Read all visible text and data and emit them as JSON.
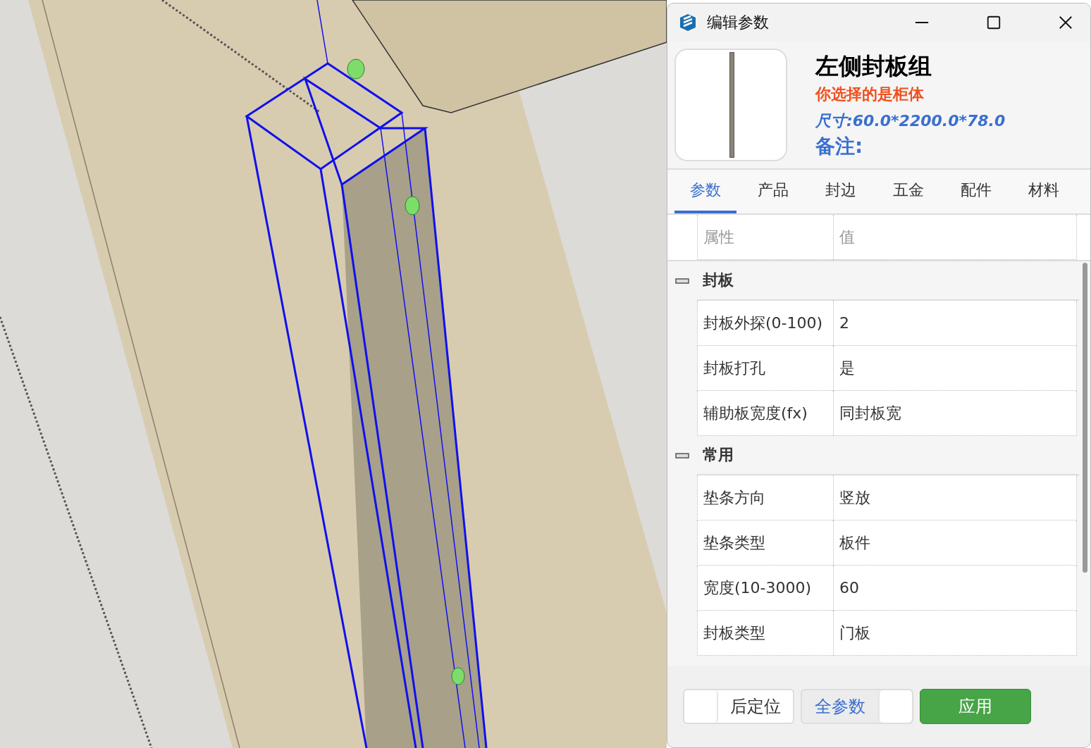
{
  "window": {
    "title": "编辑参数"
  },
  "header": {
    "name": "左侧封板组",
    "selection_note": "你选择的是柜体",
    "size": "尺寸:60.0*2200.0*78.0",
    "remark": "备注:"
  },
  "tabs": [
    {
      "label": "参数",
      "selected": true
    },
    {
      "label": "产品",
      "selected": false
    },
    {
      "label": "封边",
      "selected": false
    },
    {
      "label": "五金",
      "selected": false
    },
    {
      "label": "配件",
      "selected": false
    },
    {
      "label": "材料",
      "selected": false
    }
  ],
  "table": {
    "columns": [
      "属性",
      "值"
    ],
    "groups": [
      {
        "name": "封板",
        "expanded": true,
        "rows": [
          {
            "property": "封板外探(0-100)",
            "value": "2"
          },
          {
            "property": "封板打孔",
            "value": "是"
          },
          {
            "property": "辅助板宽度(fx)",
            "value": "同封板宽"
          }
        ]
      },
      {
        "name": "常用",
        "expanded": true,
        "rows": [
          {
            "property": "垫条方向",
            "value": "竖放"
          },
          {
            "property": "垫条类型",
            "value": "板件"
          },
          {
            "property": "宽度(10-3000)",
            "value": "60"
          },
          {
            "property": "封板类型",
            "value": "门板"
          }
        ]
      }
    ]
  },
  "footer": {
    "toggles": [
      {
        "label": "后定位",
        "on": false
      },
      {
        "label": "全参数",
        "on": true
      }
    ],
    "apply_button": "应用"
  }
}
